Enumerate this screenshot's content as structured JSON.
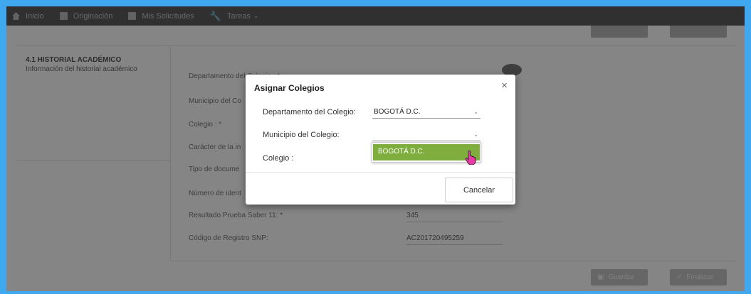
{
  "nav": {
    "items": [
      {
        "label": "Inicio",
        "icon": "home-icon"
      },
      {
        "label": "Originación",
        "icon": "document-icon"
      },
      {
        "label": "Mis Solicitudes",
        "icon": "document-icon"
      },
      {
        "label": "Tareas",
        "icon": "wrench-icon"
      }
    ]
  },
  "section": {
    "title": "4.1 HISTORIAL ACADÉMICO",
    "subtitle": "Información del historial académico"
  },
  "form": {
    "labels": [
      "Departamento del Colegio : *",
      "Municipio del Co",
      "Colegio : *",
      "Carácter de la in",
      "Tipo de docume",
      "Número de ident",
      "Resultado Prueba Saber 11: *",
      "Código de Registro SNP:"
    ],
    "values": {
      "saber11": "345",
      "snp": "AC201720495259"
    }
  },
  "buttons": {
    "save": "Guardar",
    "finish": "Finalizar"
  },
  "modal": {
    "title": "Asignar Colegios",
    "close": "×",
    "dept_label": "Departamento del Colegio:",
    "dept_value": "BOGOTÁ D.C.",
    "muni_label": "Municipio del Colegio:",
    "muni_value": "",
    "colegio_label": "Colegio :",
    "dropdown_option": "BOGOTÁ D.C.",
    "cancel": "Cancelar"
  },
  "colors": {
    "nav_bg": "#5c5c5c",
    "accent_green": "#7fae3f",
    "frame_border": "#3fa8ee"
  }
}
